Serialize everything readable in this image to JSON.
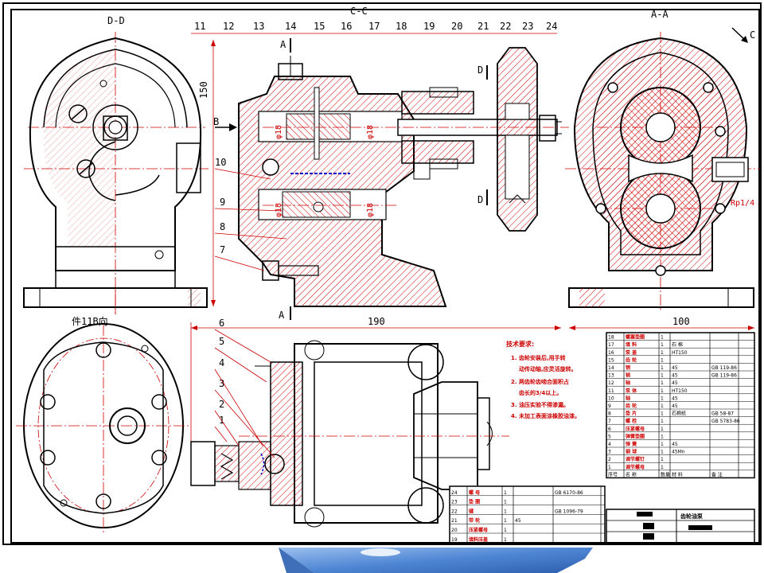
{
  "views": {
    "dd_label": "D-D",
    "cc_label": "C-C",
    "aa_label": "A-A",
    "c_arrow_label": "C",
    "b_arrow_label": "B",
    "bottom_left_label": "件11B向"
  },
  "section_marks": [
    "A",
    "A",
    "D",
    "D"
  ],
  "callouts": [
    "11",
    "12",
    "13",
    "14",
    "15",
    "16",
    "17",
    "18",
    "19",
    "20",
    "21",
    "22",
    "23",
    "24",
    "10",
    "9",
    "8",
    "7",
    "6",
    "5",
    "4",
    "3",
    "2",
    "1"
  ],
  "dimensions": {
    "height_150": "150",
    "width_190": "190",
    "width_100": "100",
    "fit_1": "φ18",
    "fit_2": "φ18",
    "fit_3": "φ18",
    "fit_4": "φ18",
    "right_note": "Rp1/4"
  },
  "technical_requirements": {
    "title": "技术要求:",
    "items": [
      "1. 齿轮安装后,用手转",
      "动传动轴,应灵活旋转。",
      "2. 两齿轮齿啮合面积占",
      "齿长的3/4以上。",
      "3. 油压实验不得渗漏。",
      "4. 未加工表面涂橡胶油漆。"
    ]
  },
  "parts_list_upper": [
    [
      "18",
      "螺塞垫圈",
      "1",
      "",
      "",
      ""
    ],
    [
      "17",
      "填  料",
      "1",
      "石  棉",
      "",
      ""
    ],
    [
      "16",
      "泵  盖",
      "1",
      "HT150",
      "",
      ""
    ],
    [
      "15",
      "齿  轮",
      "1",
      "",
      "",
      ""
    ],
    [
      "14",
      "销",
      "1",
      "45",
      "GB 119-86",
      ""
    ],
    [
      "13",
      "销",
      "1",
      "45",
      "GB 119-86",
      ""
    ],
    [
      "12",
      "轴",
      "1",
      "45",
      "",
      ""
    ],
    [
      "11",
      "泵  体",
      "1",
      "HT150",
      "",
      ""
    ],
    [
      "10",
      "轴",
      "1",
      "45",
      "",
      ""
    ],
    [
      "9",
      "齿  轮",
      "1",
      "45",
      "",
      ""
    ],
    [
      "8",
      "垫  片",
      "1",
      "石棉纸",
      "GB 58-87",
      ""
    ],
    [
      "7",
      "螺  栓",
      "1",
      "",
      "GB 5783-86",
      ""
    ],
    [
      "6",
      "压紧螺母",
      "1",
      "",
      "",
      ""
    ],
    [
      "5",
      "弹簧垫圈",
      "1",
      "",
      "",
      ""
    ],
    [
      "4",
      "弹  簧",
      "1",
      "45",
      "",
      ""
    ],
    [
      "3",
      "钢  球",
      "1",
      "45Mn",
      "",
      ""
    ],
    [
      "2",
      "调节螺钉",
      "1",
      "",
      "",
      ""
    ],
    [
      "1",
      "调节螺母",
      "1",
      "",
      "",
      ""
    ]
  ],
  "parts_list_upper_header": [
    "序号",
    "名  称",
    "数量",
    "材  料",
    "备  注"
  ],
  "parts_list_lower": [
    [
      "24",
      "螺  母",
      "1",
      "",
      "GB 6170-86",
      ""
    ],
    [
      "23",
      "垫  圈",
      "1",
      "",
      "",
      ""
    ],
    [
      "22",
      "键",
      "1",
      "",
      "GB 1096-79",
      ""
    ],
    [
      "21",
      "带  轮",
      "1",
      "45",
      "",
      ""
    ],
    [
      "20",
      "压紧螺母",
      "1",
      "",
      "",
      ""
    ],
    [
      "19",
      "填料压盖",
      "1",
      "",
      "",
      ""
    ]
  ],
  "title_block": {
    "name": "齿轮油泵",
    "drawing_no": "",
    "scale": ""
  },
  "colors": {
    "outline": "#000000",
    "section": "#cc0000",
    "hidden": "#0000cc",
    "footer_blue": "#5b8fd6"
  }
}
